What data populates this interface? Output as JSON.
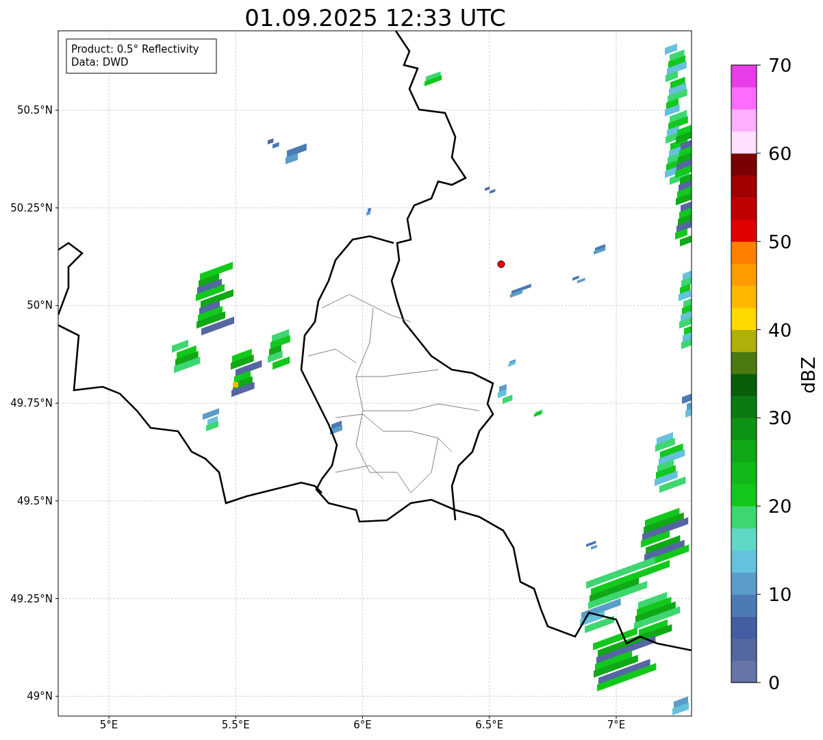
{
  "title": "01.09.2025 12:33 UTC",
  "info_box": [
    "Product: 0.5° Reflectivity",
    "Data: DWD"
  ],
  "map": {
    "x_ticks": [
      "5°E",
      "5.5°E",
      "6°E",
      "6.5°E",
      "7°E"
    ],
    "y_ticks": [
      "50.5°N",
      "50.25°N",
      "50°N",
      "49.75°N",
      "49.5°N",
      "49.25°N",
      "49°N"
    ]
  },
  "colorbar": {
    "label": "dBZ",
    "ticks": [
      "70",
      "60",
      "50",
      "40",
      "30",
      "20",
      "10",
      "0"
    ],
    "bins": [
      {
        "color": "#6674a8"
      },
      {
        "color": "#5467a0"
      },
      {
        "color": "#435ea3"
      },
      {
        "color": "#4b7ab4"
      },
      {
        "color": "#5a9dc8"
      },
      {
        "color": "#66c1dc"
      },
      {
        "color": "#60d8c6"
      },
      {
        "color": "#3ed670"
      },
      {
        "color": "#12c81c"
      },
      {
        "color": "#12b818"
      },
      {
        "color": "#10a816"
      },
      {
        "color": "#0e9414"
      },
      {
        "color": "#0c7a12"
      },
      {
        "color": "#085e0a"
      },
      {
        "color": "#4a7a10"
      },
      {
        "color": "#b0b00a"
      },
      {
        "color": "#ffd800"
      },
      {
        "color": "#ffb800"
      },
      {
        "color": "#ff9c00"
      },
      {
        "color": "#ff8000"
      },
      {
        "color": "#e00000"
      },
      {
        "color": "#c00000"
      },
      {
        "color": "#a00000"
      },
      {
        "color": "#780000"
      },
      {
        "color": "#ffe0ff"
      },
      {
        "color": "#ffb0ff"
      },
      {
        "color": "#ff6cff"
      },
      {
        "color": "#e83ce8"
      }
    ]
  }
}
